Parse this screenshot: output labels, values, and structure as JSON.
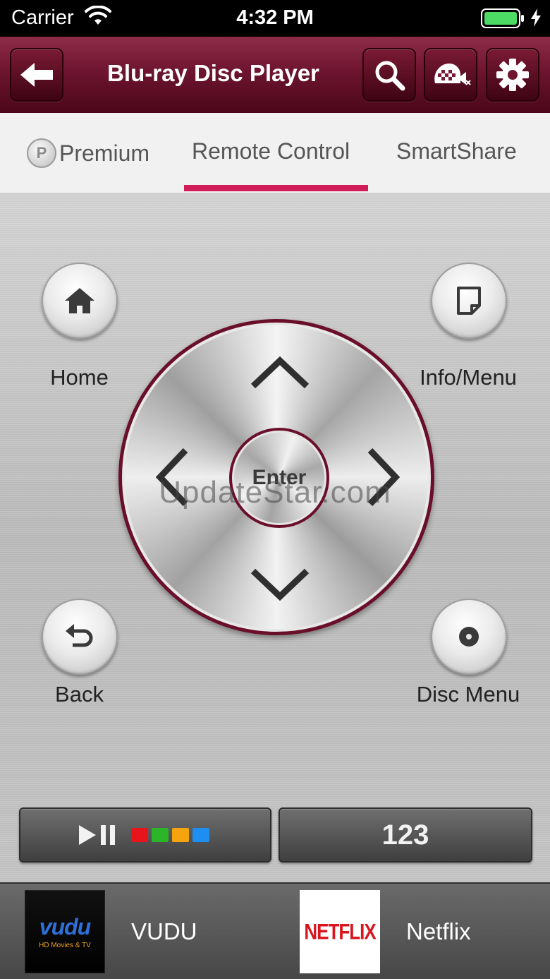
{
  "status_bar": {
    "carrier": "Carrier",
    "time": "4:32 PM"
  },
  "header": {
    "title": "Blu-ray Disc Player"
  },
  "tabs": [
    {
      "label": "Premium",
      "icon_letter": "P"
    },
    {
      "label": "Remote Control",
      "active": true
    },
    {
      "label": "SmartShare"
    }
  ],
  "remote": {
    "home_label": "Home",
    "info_menu_label": "Info/Menu",
    "back_label": "Back",
    "disc_menu_label": "Disc Menu",
    "enter_label": "Enter",
    "numpad_label": "123",
    "color_keys": [
      "#e8141c",
      "#2db52a",
      "#f5a40f",
      "#1e8ef0"
    ]
  },
  "watermark": "UpdateStar.com",
  "apps": [
    {
      "tile_logo": "vudu",
      "tile_sub": "HD Movies & TV",
      "name": "VUDU"
    },
    {
      "tile_logo": "NETFLIX",
      "name": "Netflix"
    }
  ],
  "colors": {
    "accent": "#d01d5a",
    "header": "#6e1530",
    "dpad_ring": "#6a0f2a"
  }
}
